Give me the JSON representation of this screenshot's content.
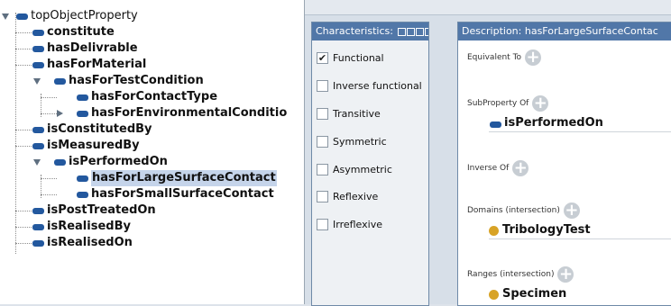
{
  "tree": {
    "root": "topObjectProperty",
    "items": [
      {
        "label": "constitute"
      },
      {
        "label": "hasDelivrable"
      },
      {
        "label": "hasForMaterial"
      },
      {
        "label": "hasForTestCondition",
        "children": [
          {
            "label": "hasForContactType"
          },
          {
            "label": "hasForEnvironmentalConditio"
          }
        ]
      },
      {
        "label": "isConstitutedBy"
      },
      {
        "label": "isMeasuredBy"
      },
      {
        "label": "isPerformedOn",
        "children": [
          {
            "label": "hasForLargeSurfaceContact",
            "selected": true
          },
          {
            "label": "hasForSmallSurfaceContact"
          }
        ]
      },
      {
        "label": "isPostTreatedOn"
      },
      {
        "label": "isRealisedBy"
      },
      {
        "label": "isRealisedOn"
      }
    ]
  },
  "characteristics": {
    "header": "Characteristics:",
    "items": [
      {
        "label": "Functional",
        "checked": true
      },
      {
        "label": "Inverse functional",
        "checked": false
      },
      {
        "label": "Transitive",
        "checked": false
      },
      {
        "label": "Symmetric",
        "checked": false
      },
      {
        "label": "Asymmetric",
        "checked": false
      },
      {
        "label": "Reflexive",
        "checked": false
      },
      {
        "label": "Irreflexive",
        "checked": false
      }
    ]
  },
  "description": {
    "header": "Description: hasForLargeSurfaceContac",
    "equivalent_label": "Equivalent To",
    "subproperty_label": "SubProperty Of",
    "subproperty_value": "isPerformedOn",
    "inverse_label": "Inverse Of",
    "domains_label": "Domains (intersection)",
    "domains_value": "TribologyTest",
    "ranges_label": "Ranges (intersection)",
    "ranges_value": "Specimen"
  },
  "colors": {
    "property_icon": "#23589e",
    "class_icon": "#d8a326",
    "header_bg": "#5177a8",
    "selection": "#c5d4ea"
  },
  "icons": {
    "expanded": "triangle-down-icon",
    "collapsed": "triangle-right-icon",
    "add": "add-circle-icon",
    "property": "object-property-icon",
    "class": "class-icon"
  }
}
